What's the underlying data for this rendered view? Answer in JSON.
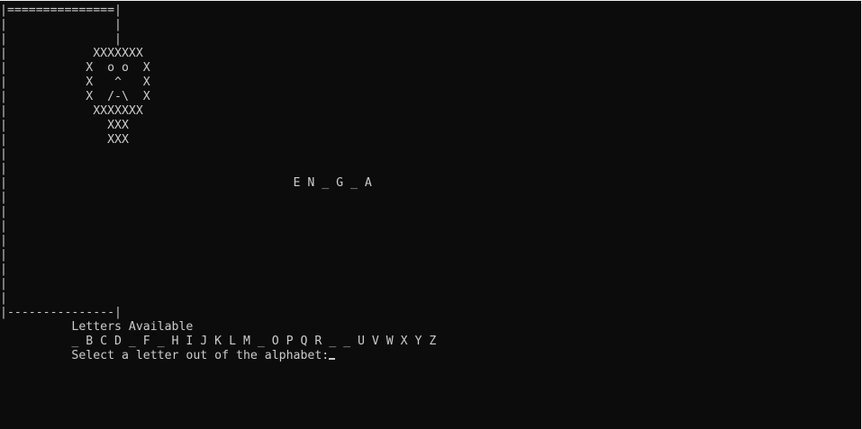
{
  "terminal": {
    "gallows_lines": [
      "|===============|",
      "|               |",
      "|               |",
      "|            XXXXXXX",
      "|           X  o o  X",
      "|           X   ^   X",
      "|           X  /-\\  X",
      "|            XXXXXXX",
      "|              XXX",
      "|              XXX",
      "|",
      "|",
      "|                                        E N _ G _ A",
      "|",
      "|",
      "|",
      "|",
      "|",
      "|",
      "|",
      "|",
      "|---------------|"
    ],
    "letters_heading": "          Letters Available",
    "letters_list": "          _ B C D _ F _ H I J K L M _ O P Q R _ _ U V W X Y Z",
    "prompt": "          Select a letter out of the alphabet:"
  }
}
